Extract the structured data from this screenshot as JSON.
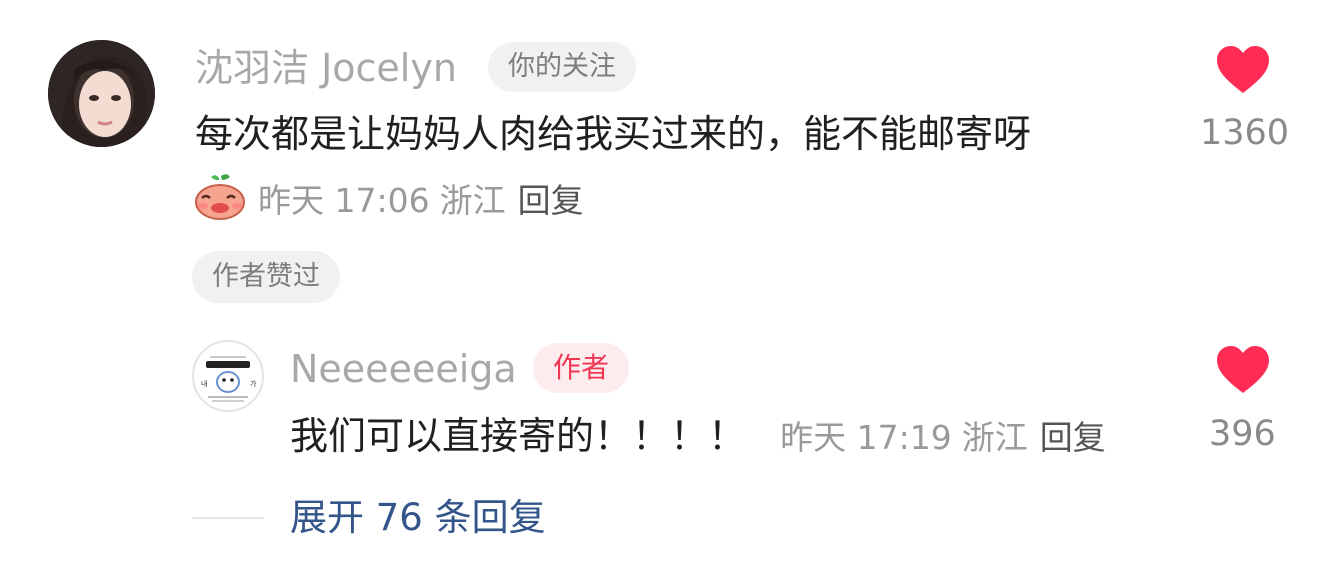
{
  "comment": {
    "username": "沈羽洁 Jocelyn",
    "follow_badge": "你的关注",
    "text": "每次都是让妈妈人肉给我买过来的，能不能邮寄呀",
    "time": "昨天 17:06",
    "location": "浙江",
    "reply_label": "回复",
    "like_count": "1360",
    "author_liked_badge": "作者赞过",
    "sticker_icon": "blushing-peach-sticker-icon"
  },
  "reply": {
    "username": "Neeeeeeiga",
    "author_badge": "作者",
    "text": "我们可以直接寄的！！！！",
    "time": "昨天 17:19",
    "location": "浙江",
    "reply_label": "回复",
    "like_count": "396",
    "avatar_logo_text": "Neeeeeeiga"
  },
  "expand": {
    "label": "展开 76 条回复"
  },
  "colors": {
    "heart": "#fe2c55",
    "author_badge_bg": "#fdecee",
    "author_badge_text": "#f03552",
    "expand_text": "#33558a"
  }
}
